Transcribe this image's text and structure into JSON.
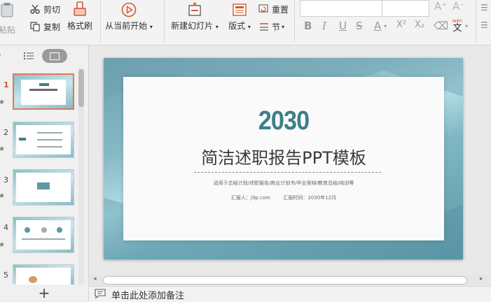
{
  "ribbon": {
    "paste_label": "粘贴",
    "cut_label": "剪切",
    "copy_label": "复制",
    "format_painter_label": "格式刷",
    "from_current_label": "从当前开始",
    "new_slide_label": "新建幻灯片",
    "layout_label": "版式",
    "reset_label": "重置",
    "section_label": "节",
    "font_grow": "A⁺",
    "font_shrink": "A⁻",
    "bold": "B",
    "italic": "I",
    "underline": "U",
    "strike": "S",
    "font_color": "A",
    "superscript": "X²",
    "subscript": "X₂",
    "eraser": "⌫",
    "wen_label": "wén",
    "wen_char": "文"
  },
  "sidebar": {
    "slide_numbers": [
      "1",
      "2",
      "3",
      "4",
      "5"
    ],
    "add_slide": "+"
  },
  "slide": {
    "year": "2030",
    "title": "简洁述职报告PPT模板",
    "subtitle": "适用于总结计划/述职报告/商业计划书/毕业答辩/教育总结/培训等",
    "reporter": "汇报人：j9p.com",
    "report_time": "汇报时间：2030年12月"
  },
  "notes": {
    "placeholder": "单击此处添加备注"
  },
  "colors": {
    "accent": "#d5572c",
    "teal": "#3d7f87",
    "slide_bg": "#87b9c6"
  }
}
